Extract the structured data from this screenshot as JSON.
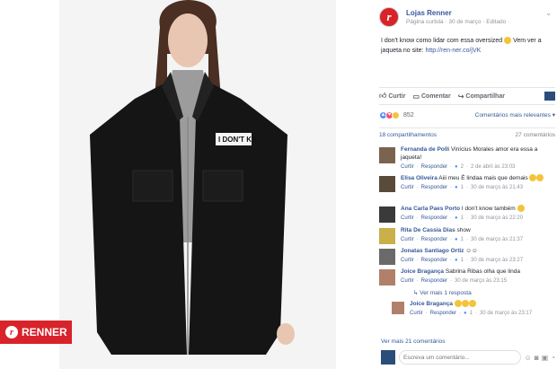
{
  "brand_badge": "RENNER",
  "post": {
    "page_name": "Lojas Renner",
    "meta": "Página curtida · 30 de março · Editado ·",
    "text": "I don't know como lidar com essa oversized",
    "text2": " Vem ver a jaqueta no site:",
    "link": "http://ren-ner.co/jVK"
  },
  "actions": {
    "like": "Curtir",
    "comment": "Comentar",
    "share": "Compartilhar"
  },
  "reactions": {
    "count": "852",
    "sort": "Comentários mais relevantes ▾"
  },
  "counts": {
    "shares": "18 compartilhamentos",
    "comments": "27 comentários"
  },
  "comments": [
    {
      "name": "Fernanda de Polli",
      "text": "Vinícius Morales amor era essa a jaqueta!",
      "like": "Curtir",
      "reply": "Responder",
      "likes": "2",
      "time": "2 de abril às 23:03"
    },
    {
      "name": "Elisa Oliveira",
      "text": "Aiii meu  É lindaa mais que demais",
      "like": "Curtir",
      "reply": "Responder",
      "likes": "1",
      "time": "30 de março às 21:43"
    },
    {
      "name": "Ana Carla Paes Porto",
      "text": "I don't know também",
      "like": "Curtir",
      "reply": "Responder",
      "likes": "1",
      "time": "30 de março às 22:20"
    },
    {
      "name": "Rita De Cassia Dias",
      "text": "show",
      "like": "Curtir",
      "reply": "Responder",
      "likes": "1",
      "time": "30 de março às 21:37"
    },
    {
      "name": "Jonatas Santiago Ortiz",
      "text": "☺☺",
      "like": "Curtir",
      "reply": "Responder",
      "likes": "1",
      "time": "30 de março às 23:27"
    },
    {
      "name": "Joice Bragança",
      "text": "Sabrina Ribas olha que linda",
      "like": "Curtir",
      "reply": "Responder",
      "likes": "",
      "time": "30 de março às 23:15"
    }
  ],
  "view_replies": "Ver mais 1 resposta",
  "reply": {
    "name": "Joice Bragança",
    "like": "Curtir",
    "reply": "Responder",
    "likes": "1",
    "time": "30 de março às 23:17"
  },
  "more_comments": "Ver mais 21 comentários",
  "composer": {
    "placeholder": "Escreva um comentário..."
  }
}
